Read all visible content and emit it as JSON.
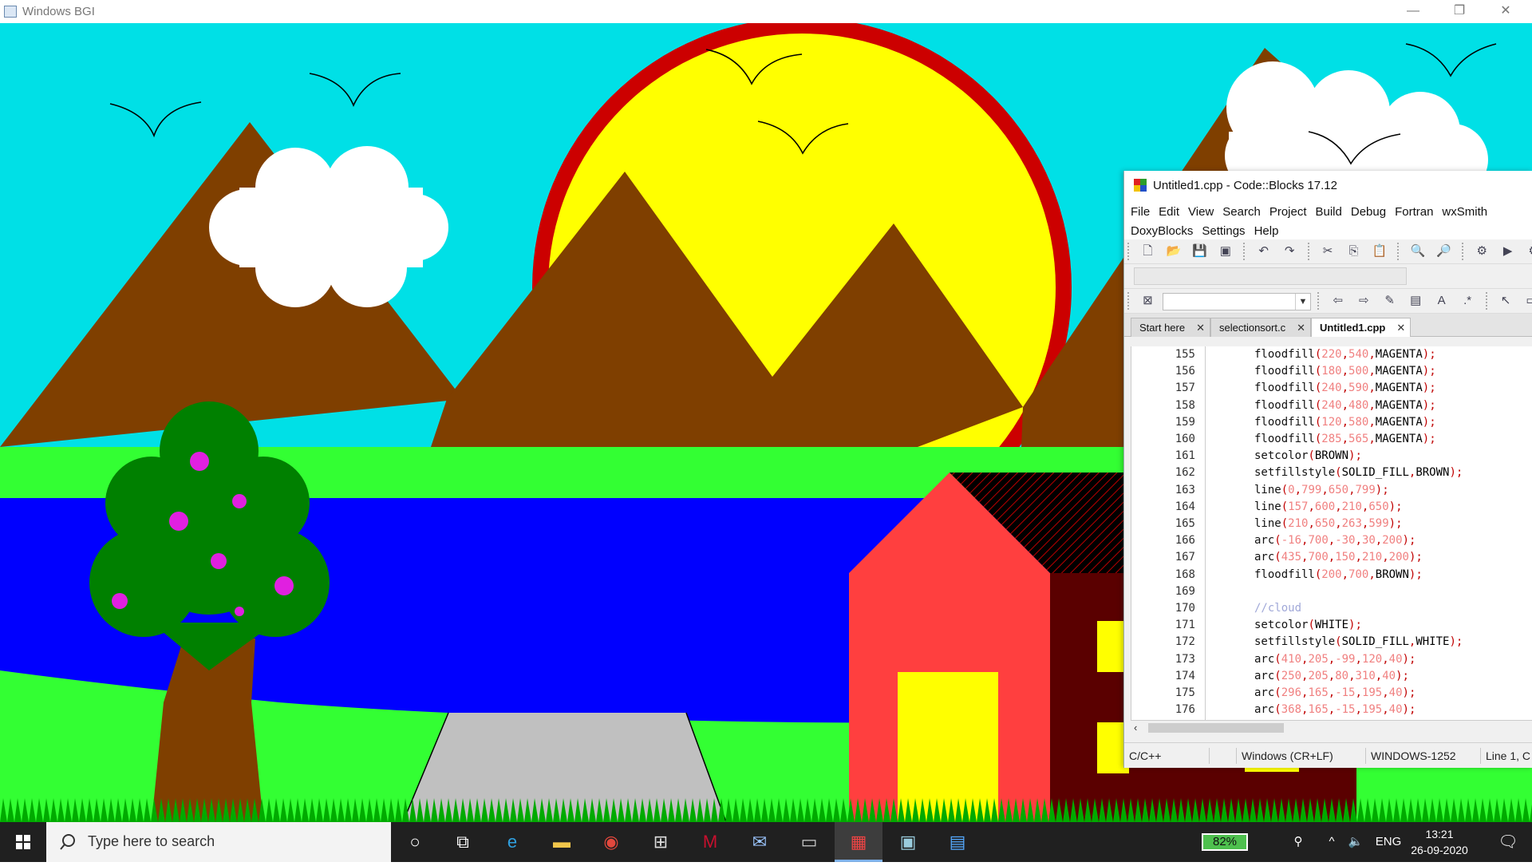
{
  "bgi_window": {
    "title": "Windows BGI",
    "controls": {
      "minimize": "—",
      "restore": "❐",
      "close": "✕"
    }
  },
  "scene": {
    "colors": {
      "sky": "#00E0E6",
      "sun": "#FFFF00",
      "sun_ring": "#CC0000",
      "mountain": "#7F3F00",
      "grass": "#33FF33",
      "lake": "#0000FF",
      "road": "#C0C0C0",
      "tree_leaves": "#008000",
      "fruit": "#E020E0",
      "house_wall": "#FF3F3F",
      "house_side": "#5A0000",
      "door": "#FFFF00",
      "cloud": "#FFFFFF",
      "grass_tufts": "#00AA00"
    }
  },
  "codeblocks": {
    "title": "Untitled1.cpp - Code::Blocks 17.12",
    "menu_row1": [
      "File",
      "Edit",
      "View",
      "Search",
      "Project",
      "Build",
      "Debug",
      "Fortran",
      "wxSmith"
    ],
    "menu_row2": [
      "DoxyBlocks",
      "Settings",
      "Help"
    ],
    "tabs": [
      {
        "label": "Start here",
        "active": false
      },
      {
        "label": "selectionsort.c",
        "active": false
      },
      {
        "label": "Untitled1.cpp",
        "active": true
      }
    ],
    "code_lines": [
      {
        "n": "155",
        "text": "floodfill(220,540,MAGENTA);"
      },
      {
        "n": "156",
        "text": "floodfill(180,500,MAGENTA);"
      },
      {
        "n": "157",
        "text": "floodfill(240,590,MAGENTA);"
      },
      {
        "n": "158",
        "text": "floodfill(240,480,MAGENTA);"
      },
      {
        "n": "159",
        "text": "floodfill(120,580,MAGENTA);"
      },
      {
        "n": "160",
        "text": "floodfill(285,565,MAGENTA);"
      },
      {
        "n": "161",
        "text": "setcolor(BROWN);"
      },
      {
        "n": "162",
        "text": "setfillstyle(SOLID_FILL,BROWN);"
      },
      {
        "n": "163",
        "text": "line(0,799,650,799);"
      },
      {
        "n": "164",
        "text": "line(157,600,210,650);"
      },
      {
        "n": "165",
        "text": "line(210,650,263,599);"
      },
      {
        "n": "166",
        "text": "arc(-16,700,-30,30,200);"
      },
      {
        "n": "167",
        "text": "arc(435,700,150,210,200);"
      },
      {
        "n": "168",
        "text": "floodfill(200,700,BROWN);"
      },
      {
        "n": "169",
        "text": ""
      },
      {
        "n": "170",
        "text": "//cloud"
      },
      {
        "n": "171",
        "text": "setcolor(WHITE);"
      },
      {
        "n": "172",
        "text": "setfillstyle(SOLID_FILL,WHITE);"
      },
      {
        "n": "173",
        "text": "arc(410,205,-99,120,40);"
      },
      {
        "n": "174",
        "text": "arc(250,205,80,310,40);"
      },
      {
        "n": "175",
        "text": "arc(296,165,-15,195,40);"
      },
      {
        "n": "176",
        "text": "arc(368,165,-15,195,40);"
      }
    ],
    "status": {
      "language": "C/C++",
      "line_endings": "Windows (CR+LF)",
      "encoding": "WINDOWS-1252",
      "position": "Line 1, C"
    }
  },
  "taskbar": {
    "search_placeholder": "Type here to search",
    "battery": "82%",
    "language": "ENG",
    "time": "13:21",
    "date": "26-09-2020"
  }
}
